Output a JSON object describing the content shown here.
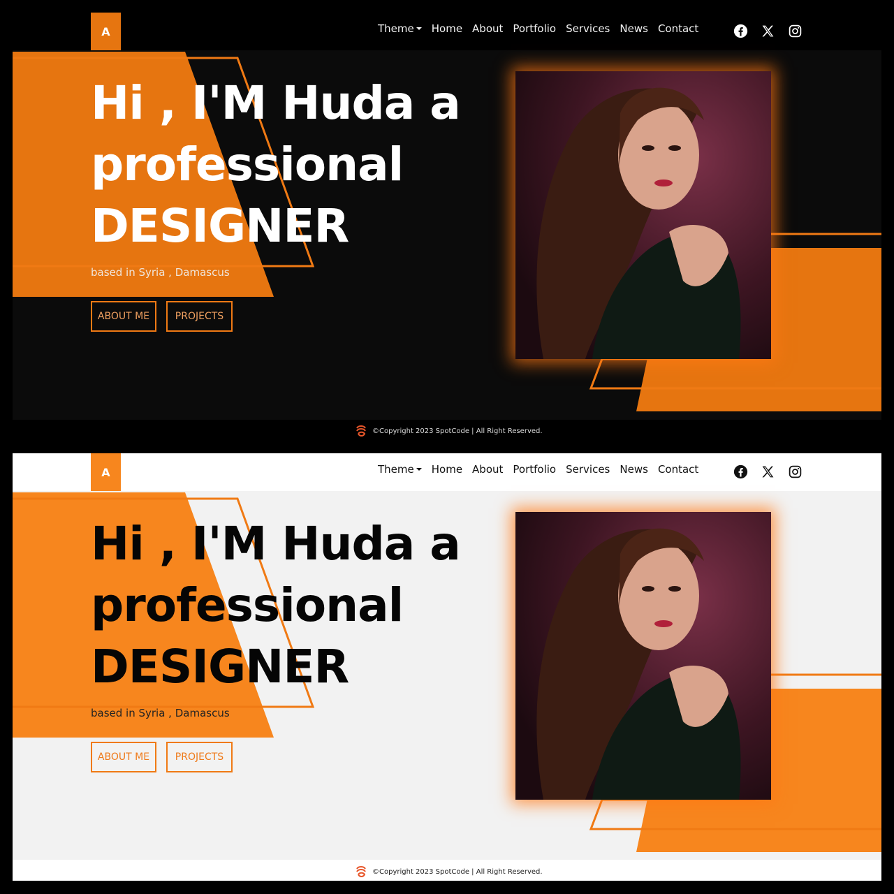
{
  "navbar": {
    "logo": "A",
    "links": [
      "Theme",
      "Home",
      "About",
      "Portfolio",
      "Services",
      "News",
      "Contact"
    ],
    "socials": [
      "facebook-icon",
      "x-icon",
      "instagram-icon"
    ]
  },
  "hero": {
    "title_line1": "Hi , I'M Huda a",
    "title_line2": "professional",
    "title_line3": "DESIGNER",
    "subtitle": "based in Syria , Damascus",
    "about_button": "ABOUT ME",
    "projects_button": "PROJECTS"
  },
  "footer": {
    "text": "©Copyright 2023 SpotCode | All Right Reserved."
  },
  "colors": {
    "accent_dark": "#e67510",
    "accent_light": "#f7861e",
    "dark_bg": "#0b0b0b",
    "light_bg": "#f2f2f2"
  }
}
